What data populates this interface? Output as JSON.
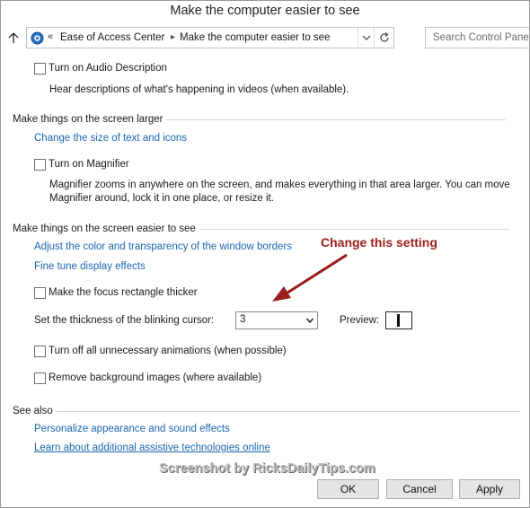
{
  "window": {
    "title": "Make the computer easier to see"
  },
  "nav": {
    "breadcrumb_separator": "«",
    "breadcrumb": [
      "Ease of Access Center",
      "Make the computer easier to see"
    ],
    "search_placeholder": "Search Control Panel"
  },
  "audio": {
    "checkbox_label": "Turn on Audio Description",
    "description": "Hear descriptions of what's happening in videos (when available)."
  },
  "larger": {
    "heading": "Make things on the screen larger",
    "link_text_size": "Change the size of text and icons",
    "magnifier_label": "Turn on Magnifier",
    "magnifier_desc_1": "Magnifier zooms in anywhere on the screen, and makes everything in that area larger. You can move",
    "magnifier_desc_2": "Magnifier around, lock it in one place, or resize it."
  },
  "easier": {
    "heading": "Make things on the screen easier to see",
    "link_color": "Adjust the color and transparency of the window borders",
    "link_display": "Fine tune display effects",
    "focus_label": "Make the focus rectangle thicker",
    "cursor_label": "Set the thickness of the blinking cursor:",
    "cursor_value": "3",
    "preview_label": "Preview:",
    "animations_label": "Turn off all unnecessary animations (when possible)",
    "background_label": "Remove background images (where available)"
  },
  "see_also": {
    "heading": "See also",
    "link_personalize": "Personalize appearance and sound effects",
    "link_assistive": "Learn about additional assistive technologies online"
  },
  "annotation": {
    "text": "Change this setting",
    "color": "#9b1d1d"
  },
  "watermark": "Screenshot by RicksDailyTips.com",
  "buttons": {
    "ok": "OK",
    "cancel": "Cancel",
    "apply": "Apply"
  },
  "colors": {
    "link": "#1a65b0"
  }
}
